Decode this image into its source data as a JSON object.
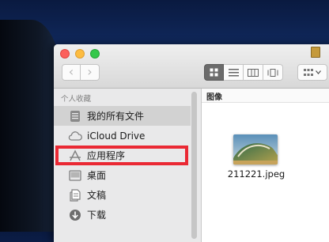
{
  "sidebar": {
    "section_header": "个人收藏",
    "items": [
      {
        "label": "我的所有文件",
        "icon": "all-files-icon",
        "selected": true
      },
      {
        "label": "iCloud Drive",
        "icon": "cloud-icon",
        "selected": false
      },
      {
        "label": "应用程序",
        "icon": "applications-icon",
        "selected": false
      },
      {
        "label": "桌面",
        "icon": "desktop-icon",
        "selected": false
      },
      {
        "label": "文稿",
        "icon": "documents-icon",
        "selected": false
      },
      {
        "label": "下载",
        "icon": "downloads-icon",
        "selected": false
      }
    ]
  },
  "toolbar": {
    "back_glyph": "‹",
    "forward_glyph": "›",
    "view_modes": [
      "icon-view",
      "list-view",
      "column-view",
      "cover-flow-view"
    ],
    "active_view": "icon-view"
  },
  "content": {
    "folder_label": "图像",
    "files": [
      {
        "name": "211221.jpeg",
        "kind": "image"
      }
    ]
  },
  "colors": {
    "highlight_box": "#ea2934",
    "sidebar_bg": "#e9e9ea",
    "selected_row": "#d2d2d2"
  }
}
